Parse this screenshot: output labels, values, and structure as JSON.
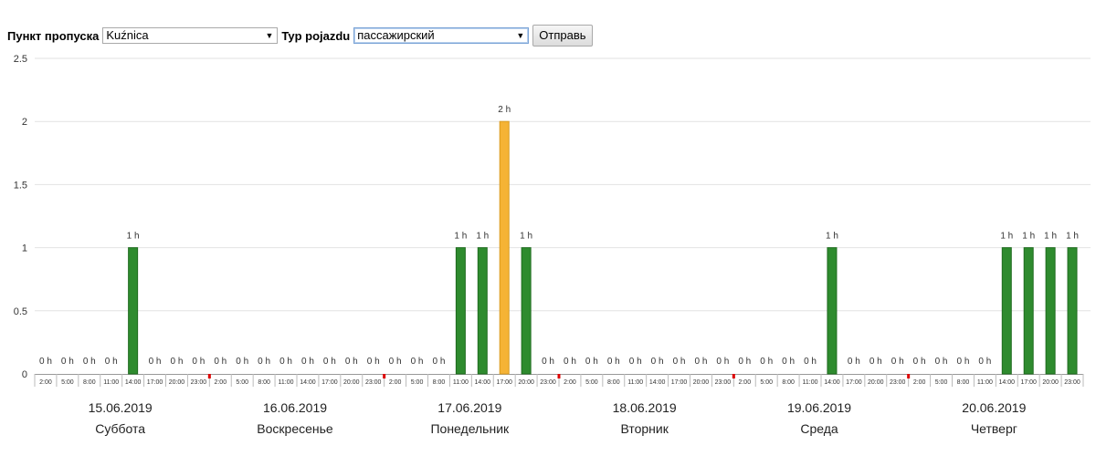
{
  "controls": {
    "checkpoint_label": "Пункт пропуска",
    "checkpoint_value": "Kuźnica",
    "vehicle_label": "Typ pojazdu",
    "vehicle_value": "пассажирский",
    "submit_label": "Отправь"
  },
  "chart_data": {
    "type": "bar",
    "ylim": [
      0,
      2.5
    ],
    "yticks": [
      "0",
      "0.5",
      "1",
      "1.5",
      "2",
      "2.5"
    ],
    "grid": true,
    "unit_suffix": " h",
    "colors": {
      "normal": "#2e8b2e",
      "highlight": "#f5b335",
      "separator": "#dd0000",
      "grid": "#e2e2e2"
    },
    "highlight_index": 21,
    "x_tick_labels": [
      "2:00",
      "5:00",
      "8:00",
      "11:00",
      "14:00",
      "17:00",
      "20:00",
      "23:00",
      "2:00",
      "5:00",
      "8:00",
      "11:00",
      "14:00",
      "17:00",
      "20:00",
      "23:00",
      "2:00",
      "5:00",
      "8:00",
      "11:00",
      "14:00",
      "17:00",
      "20:00",
      "23:00",
      "2:00",
      "5:00",
      "8:00",
      "11:00",
      "14:00",
      "17:00",
      "20:00",
      "23:00",
      "2:00",
      "5:00",
      "8:00",
      "11:00",
      "14:00",
      "17:00",
      "20:00",
      "23:00",
      "2:00",
      "5:00",
      "8:00",
      "11:00",
      "14:00",
      "17:00",
      "20:00",
      "23:00"
    ],
    "values": [
      0,
      0,
      0,
      0,
      1,
      0,
      0,
      0,
      0,
      0,
      0,
      0,
      0,
      0,
      0,
      0,
      0,
      0,
      0,
      1,
      1,
      2,
      1,
      0,
      0,
      0,
      0,
      0,
      0,
      0,
      0,
      0,
      0,
      0,
      0,
      0,
      1,
      0,
      0,
      0,
      0,
      0,
      0,
      0,
      1,
      1,
      1,
      1
    ],
    "days": [
      {
        "date": "15.06.2019",
        "weekday": "Суббота"
      },
      {
        "date": "16.06.2019",
        "weekday": "Воскресенье"
      },
      {
        "date": "17.06.2019",
        "weekday": "Понедельник"
      },
      {
        "date": "18.06.2019",
        "weekday": "Вторник"
      },
      {
        "date": "19.06.2019",
        "weekday": "Среда"
      },
      {
        "date": "20.06.2019",
        "weekday": "Четверг"
      }
    ]
  }
}
